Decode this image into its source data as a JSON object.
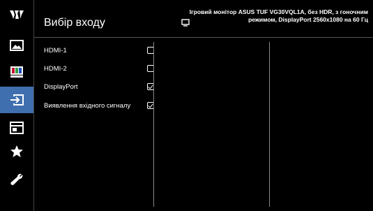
{
  "app": {
    "logo_icon": "tuf-logo-icon"
  },
  "header": {
    "title": "Вибір входу",
    "monitor_info": "Ігровий монітор ASUS TUF VG30VQL1A, без HDR, з гоночним режимом, DisplayPort 2560x1080 на 60 Гц"
  },
  "sidebar": {
    "items": [
      {
        "icon": "image-icon"
      },
      {
        "icon": "color-bars-icon"
      },
      {
        "icon": "input-select-icon",
        "active": true
      },
      {
        "icon": "system-setup-icon"
      },
      {
        "icon": "favorites-star-icon"
      },
      {
        "icon": "wrench-icon"
      }
    ]
  },
  "menu": {
    "items": [
      {
        "label": "HDMI-1",
        "checked": false
      },
      {
        "label": "HDMI-2",
        "checked": false
      },
      {
        "label": "DisplayPort",
        "checked": true
      },
      {
        "label": "Виявлення вхідного сигналу",
        "checked": true
      }
    ]
  },
  "colors": {
    "active": "#3f6fae",
    "background": "#000000",
    "text": "#ffffff"
  }
}
